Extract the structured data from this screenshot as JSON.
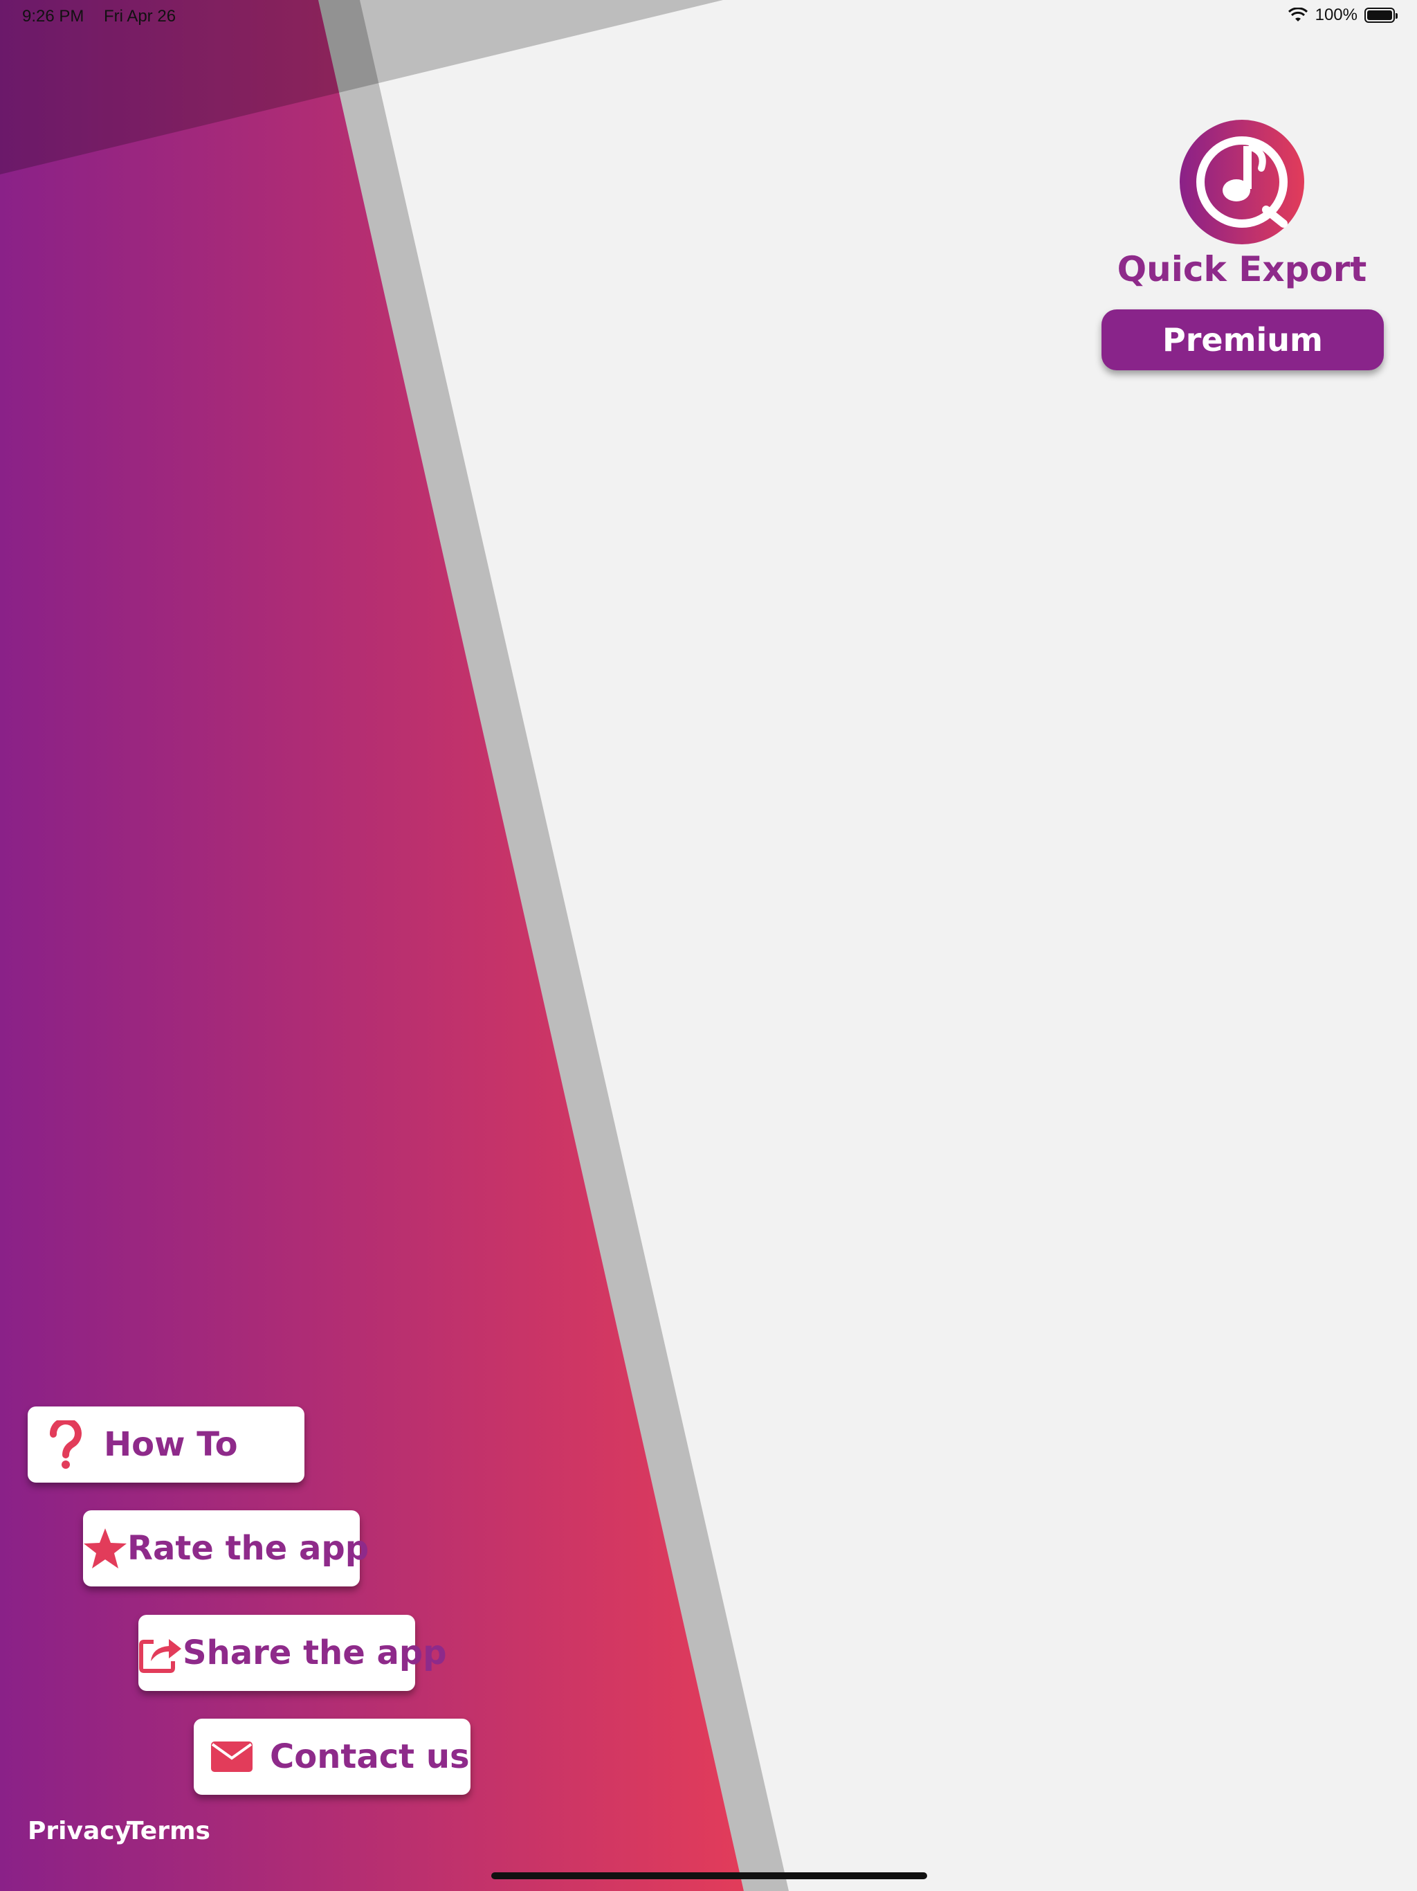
{
  "status_bar": {
    "time": "9:26 PM",
    "date": "Fri Apr 26",
    "battery_percent": "100%",
    "icons": [
      "wifi-icon",
      "battery-icon"
    ]
  },
  "app": {
    "name": "Quick Export",
    "logo_icon": "music-note-logo-icon",
    "premium_label": "Premium"
  },
  "menu": [
    {
      "label": "How To",
      "icon": "question-icon"
    },
    {
      "label": "Rate the app",
      "icon": "star-icon"
    },
    {
      "label": "Share the app",
      "icon": "share-icon"
    },
    {
      "label": "Contact us",
      "icon": "envelope-icon"
    }
  ],
  "footer": {
    "privacy": "Privacy",
    "terms": "Terms"
  },
  "colors": {
    "gradient_start": "#8a2188",
    "gradient_end": "#e23c5a",
    "accent_text": "#8e2a8a",
    "icon_red": "#e23c5a",
    "background": "#f2f2f2",
    "stripe_gray": "#bcbcbc"
  }
}
